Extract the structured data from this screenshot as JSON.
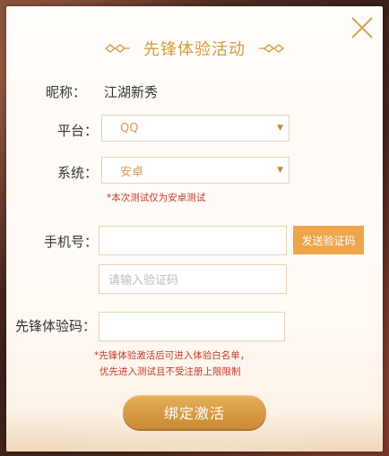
{
  "dialog": {
    "title": "先锋体验活动",
    "close_icon": "close-icon",
    "nickname": {
      "label": "昵称：",
      "value": "江湖新秀"
    },
    "platform": {
      "label": "平台：",
      "value": "QQ"
    },
    "system": {
      "label": "系统：",
      "value": "安卓",
      "note": "*本次测试仅为安卓测试"
    },
    "phone": {
      "label": "手机号：",
      "value": "",
      "send_code_label": "发送验证码",
      "code_placeholder": "请输入验证码"
    },
    "pioneer_code": {
      "label": "先锋体验码：",
      "value": "",
      "note_line1": "*先锋体验激活后可进入体验白名单，",
      "note_line2": "优先进入测试且不受注册上限限制"
    },
    "bind_button_label": "绑定激活"
  },
  "colors": {
    "accent": "#efa54b",
    "title": "#d49a3c",
    "note": "#c0392b"
  }
}
